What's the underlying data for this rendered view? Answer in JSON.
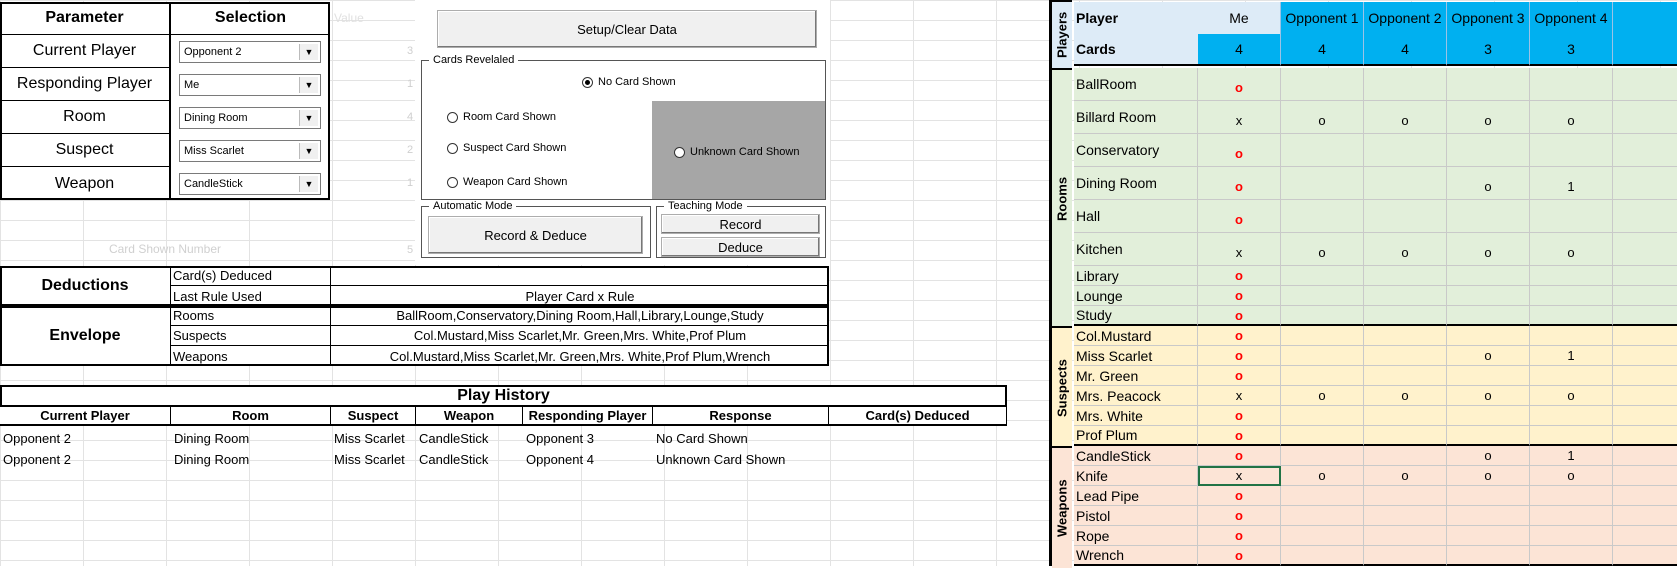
{
  "params": {
    "header_param": "Parameter",
    "header_selection": "Selection",
    "header_value": "Value",
    "rows": [
      {
        "label": "Current Player",
        "selected": "Opponent 2",
        "value": "3"
      },
      {
        "label": "Responding Player",
        "selected": "Me",
        "value": "1"
      },
      {
        "label": "Room",
        "selected": "Dining Room",
        "value": "4"
      },
      {
        "label": "Suspect",
        "selected": "Miss Scarlet",
        "value": "2"
      },
      {
        "label": "Weapon",
        "selected": "CandleStick",
        "value": "1"
      }
    ],
    "card_shown_number_label": "Card Shown Number",
    "card_shown_number_value": "5"
  },
  "controls": {
    "setup_button": "Setup/Clear Data",
    "cards_revealed_legend": "Cards Revelaled",
    "radios": {
      "no_card": "No Card Shown",
      "room_card": "Room Card Shown",
      "suspect_card": "Suspect Card Shown",
      "weapon_card": "Weapon Card Shown",
      "unknown_card": "Unknown Card Shown"
    },
    "automatic_mode_legend": "Automatic Mode",
    "record_deduce_button": "Record & Deduce",
    "teaching_mode_legend": "Teaching Mode",
    "record_button": "Record",
    "deduce_button": "Deduce"
  },
  "deductions": {
    "title": "Deductions",
    "cards_deduced_label": "Card(s) Deduced",
    "cards_deduced_value": "",
    "last_rule_label": "Last Rule Used",
    "last_rule_value": "Player Card x Rule"
  },
  "envelope": {
    "title": "Envelope",
    "rooms_label": "Rooms",
    "rooms_value": "BallRoom,Conservatory,Dining Room,Hall,Library,Lounge,Study",
    "suspects_label": "Suspects",
    "suspects_value": "Col.Mustard,Miss Scarlet,Mr. Green,Mrs. White,Prof Plum",
    "weapons_label": "Weapons",
    "weapons_value": "Col.Mustard,Miss Scarlet,Mr. Green,Mrs. White,Prof Plum,Wrench"
  },
  "history": {
    "title": "Play History",
    "headers": [
      "Current Player",
      "Room",
      "Suspect",
      "Weapon",
      "Responding Player",
      "Response",
      "Card(s) Deduced"
    ],
    "rows": [
      [
        "Opponent 2",
        "Dining Room",
        "Miss Scarlet",
        "CandleStick",
        "Opponent 3",
        "No Card Shown",
        ""
      ],
      [
        "Opponent 2",
        "Dining Room",
        "Miss Scarlet",
        "CandleStick",
        "Opponent 4",
        "Unknown Card Shown",
        ""
      ]
    ]
  },
  "tracker": {
    "section_players": "Players",
    "section_rooms": "Rooms",
    "section_suspects": "Suspects",
    "section_weapons": "Weapons",
    "player_label": "Player",
    "cards_label": "Cards",
    "players": [
      "Me",
      "Opponent 1",
      "Opponent 2",
      "Opponent 3",
      "Opponent 4"
    ],
    "card_counts": [
      "4",
      "4",
      "4",
      "3",
      "3"
    ],
    "colors": {
      "header_blue": "#ddebf7",
      "header_cyan": "#00b0f0",
      "rooms": "#e2efda",
      "suspects": "#fff2cc",
      "weapons": "#fce4d6",
      "red_mark": "#ff0000"
    },
    "rooms": [
      {
        "name": "BallRoom",
        "marks": [
          "o",
          "",
          "",
          "",
          ""
        ]
      },
      {
        "name": "Billard Room",
        "marks": [
          "x",
          "o",
          "o",
          "o",
          "o"
        ]
      },
      {
        "name": "Conservatory",
        "marks": [
          "o",
          "",
          "",
          "",
          ""
        ]
      },
      {
        "name": "Dining Room",
        "marks": [
          "o",
          "",
          "",
          "o",
          "1"
        ]
      },
      {
        "name": "Hall",
        "marks": [
          "o",
          "",
          "",
          "",
          ""
        ]
      },
      {
        "name": "Kitchen",
        "marks": [
          "x",
          "o",
          "o",
          "o",
          "o"
        ]
      },
      {
        "name": "Library",
        "marks": [
          "o",
          "",
          "",
          "",
          ""
        ]
      },
      {
        "name": "Lounge",
        "marks": [
          "o",
          "",
          "",
          "",
          ""
        ]
      },
      {
        "name": "Study",
        "marks": [
          "o",
          "",
          "",
          "",
          ""
        ]
      }
    ],
    "suspects": [
      {
        "name": "Col.Mustard",
        "marks": [
          "o",
          "",
          "",
          "",
          ""
        ]
      },
      {
        "name": "Miss Scarlet",
        "marks": [
          "o",
          "",
          "",
          "o",
          "1"
        ]
      },
      {
        "name": "Mr. Green",
        "marks": [
          "o",
          "",
          "",
          "",
          ""
        ]
      },
      {
        "name": "Mrs. Peacock",
        "marks": [
          "x",
          "o",
          "o",
          "o",
          "o"
        ]
      },
      {
        "name": "Mrs. White",
        "marks": [
          "o",
          "",
          "",
          "",
          ""
        ]
      },
      {
        "name": "Prof Plum",
        "marks": [
          "o",
          "",
          "",
          "",
          ""
        ]
      }
    ],
    "weapons": [
      {
        "name": "CandleStick",
        "marks": [
          "o",
          "",
          "",
          "o",
          "1"
        ]
      },
      {
        "name": "Knife",
        "marks": [
          "x",
          "o",
          "o",
          "o",
          "o"
        ]
      },
      {
        "name": "Lead Pipe",
        "marks": [
          "o",
          "",
          "",
          "",
          ""
        ]
      },
      {
        "name": "Pistol",
        "marks": [
          "o",
          "",
          "",
          "",
          ""
        ]
      },
      {
        "name": "Rope",
        "marks": [
          "o",
          "",
          "",
          "",
          ""
        ]
      },
      {
        "name": "Wrench",
        "marks": [
          "o",
          "",
          "",
          "",
          ""
        ]
      }
    ]
  }
}
